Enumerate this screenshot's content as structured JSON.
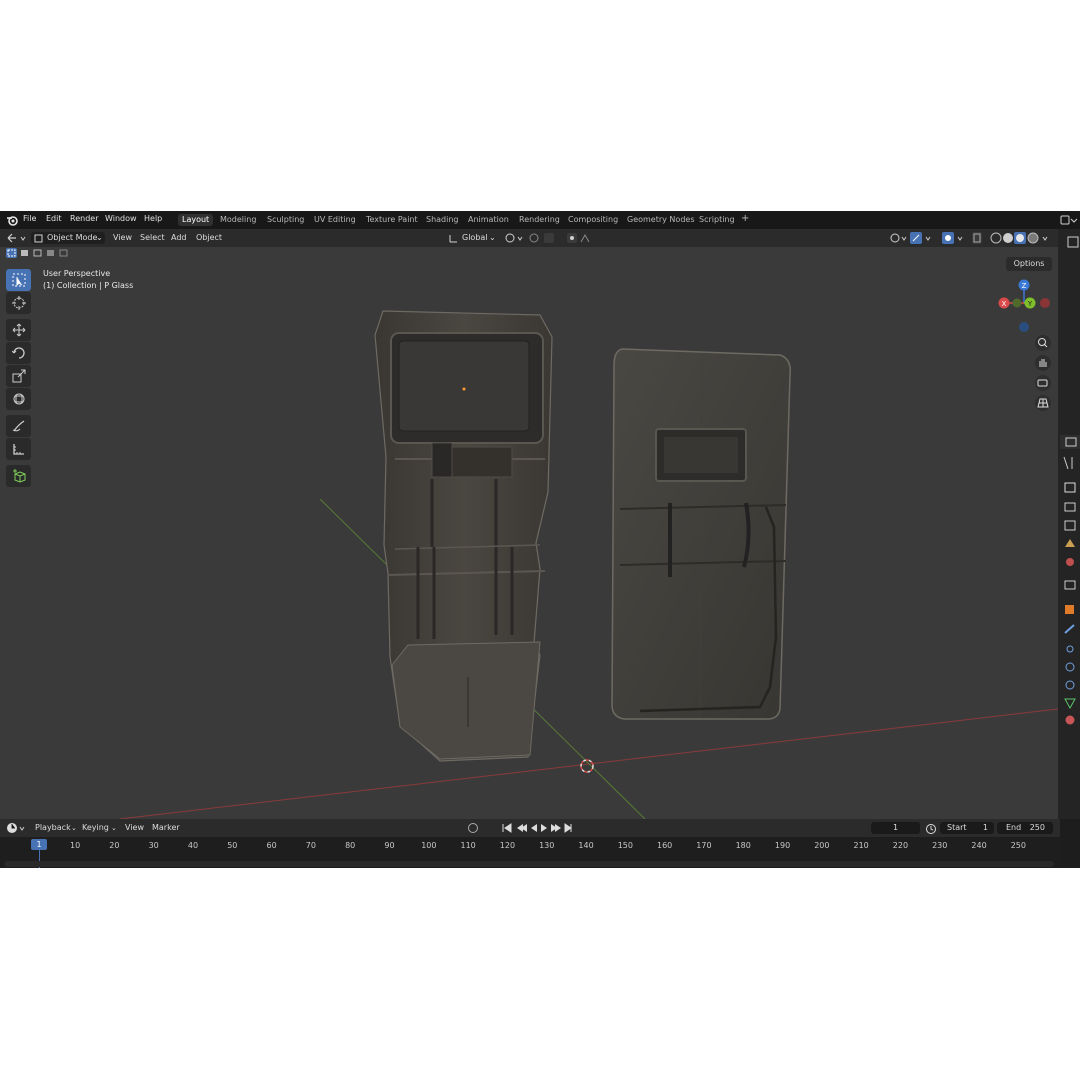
{
  "menubar": {
    "items": [
      "File",
      "Edit",
      "Render",
      "Window",
      "Help"
    ],
    "workspaces": [
      "Layout",
      "Modeling",
      "Sculpting",
      "UV Editing",
      "Texture Paint",
      "Shading",
      "Animation",
      "Rendering",
      "Compositing",
      "Geometry Nodes",
      "Scripting"
    ],
    "add_tab": "+"
  },
  "header": {
    "mode": "Object Mode",
    "menus": [
      "View",
      "Select",
      "Add",
      "Object"
    ],
    "transform_orientation": "Global",
    "options_label": "Options"
  },
  "viewport": {
    "view_name": "User Perspective",
    "collection_info": "(1) Collection | P Glass",
    "gizmo": {
      "x": "X",
      "y": "Y",
      "z": "Z"
    }
  },
  "timeline": {
    "menus": [
      "Playback",
      "Keying",
      "View",
      "Marker"
    ],
    "current_frame": "1",
    "start_label": "Start",
    "start_value": "1",
    "end_label": "End",
    "end_value": "250",
    "playhead_label": "1",
    "ticks": [
      "10",
      "20",
      "30",
      "40",
      "50",
      "60",
      "70",
      "80",
      "90",
      "100",
      "110",
      "120",
      "130",
      "140",
      "150",
      "160",
      "170",
      "180",
      "190",
      "200",
      "210",
      "220",
      "230",
      "240",
      "250"
    ]
  },
  "colors": {
    "accent": "#4772b3",
    "axis_x": "#d94a4a",
    "axis_y": "#7fbf2a",
    "axis_z": "#3a78d6"
  }
}
